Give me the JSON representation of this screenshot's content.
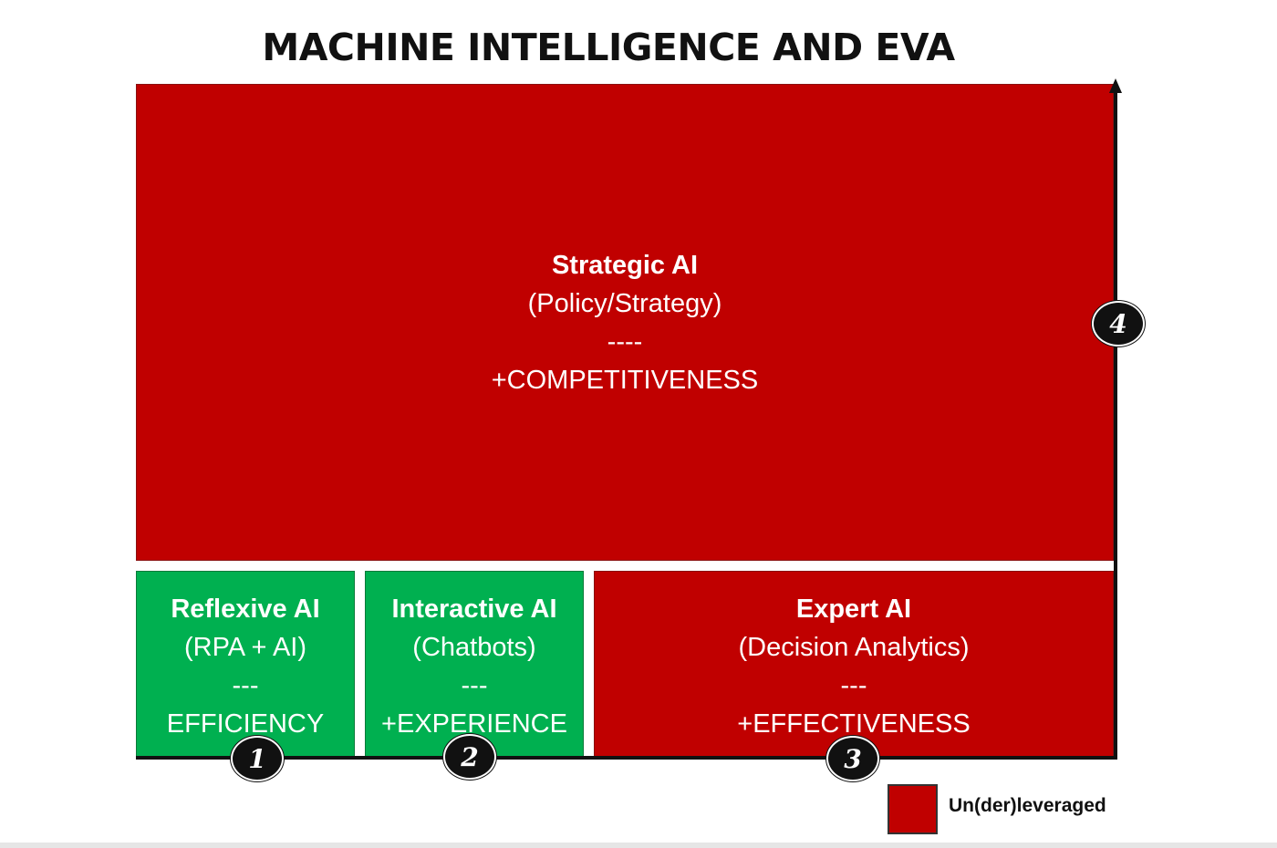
{
  "title": "MACHINE INTELLIGENCE AND EVA",
  "colors": {
    "underleveraged": "#c00000",
    "leveraged": "#00b050",
    "axis": "#111111"
  },
  "blocks": {
    "strategic": {
      "name": "Strategic AI",
      "sub": "(Policy/Strategy)",
      "sep": "----",
      "value": "+COMPETITIVENESS",
      "marker": "4"
    },
    "reflexive": {
      "name": "Reflexive AI",
      "sub": "(RPA + AI)",
      "sep": "---",
      "value": "EFFICIENCY",
      "marker": "1"
    },
    "interactive": {
      "name": "Interactive AI",
      "sub": "(Chatbots)",
      "sep": "---",
      "value": "+EXPERIENCE",
      "marker": "2"
    },
    "expert": {
      "name": "Expert AI",
      "sub": "(Decision Analytics)",
      "sep": "---",
      "value": "+EFFECTIVENESS",
      "marker": "3"
    }
  },
  "legend": {
    "label": "Un(der)leveraged"
  }
}
